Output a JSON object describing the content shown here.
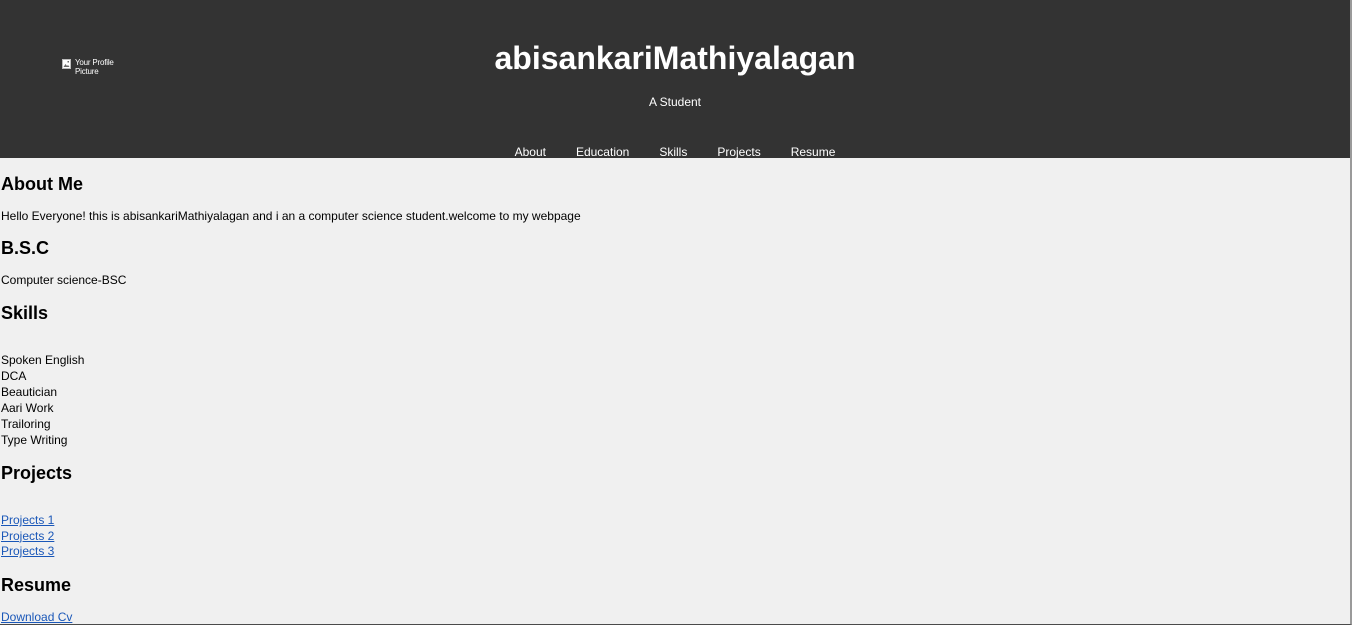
{
  "header": {
    "profile_alt": "Your Profile Picture",
    "title": "abisankariMathiyalagan",
    "subtitle": "A Student",
    "nav": [
      "About",
      "Education",
      "Skills",
      "Projects",
      "Resume"
    ]
  },
  "about": {
    "heading": "About Me",
    "text": "Hello Everyone! this is abisankariMathiyalagan and i an a computer science student.welcome to my webpage"
  },
  "education": {
    "heading": "B.S.C",
    "text": "Computer science-BSC"
  },
  "skills": {
    "heading": "Skills",
    "items": [
      "Spoken English",
      "DCA",
      "Beautician",
      "Aari Work",
      "Trailoring",
      "Type Writing"
    ]
  },
  "projects": {
    "heading": "Projects",
    "links": [
      "Projects 1",
      "Projects 2",
      "Projects 3"
    ]
  },
  "resume": {
    "heading": "Resume",
    "link": "Download Cv"
  },
  "colors": {
    "header_bg": "#333333",
    "page_bg": "#f0f0f0",
    "link": "#1a57b8"
  }
}
